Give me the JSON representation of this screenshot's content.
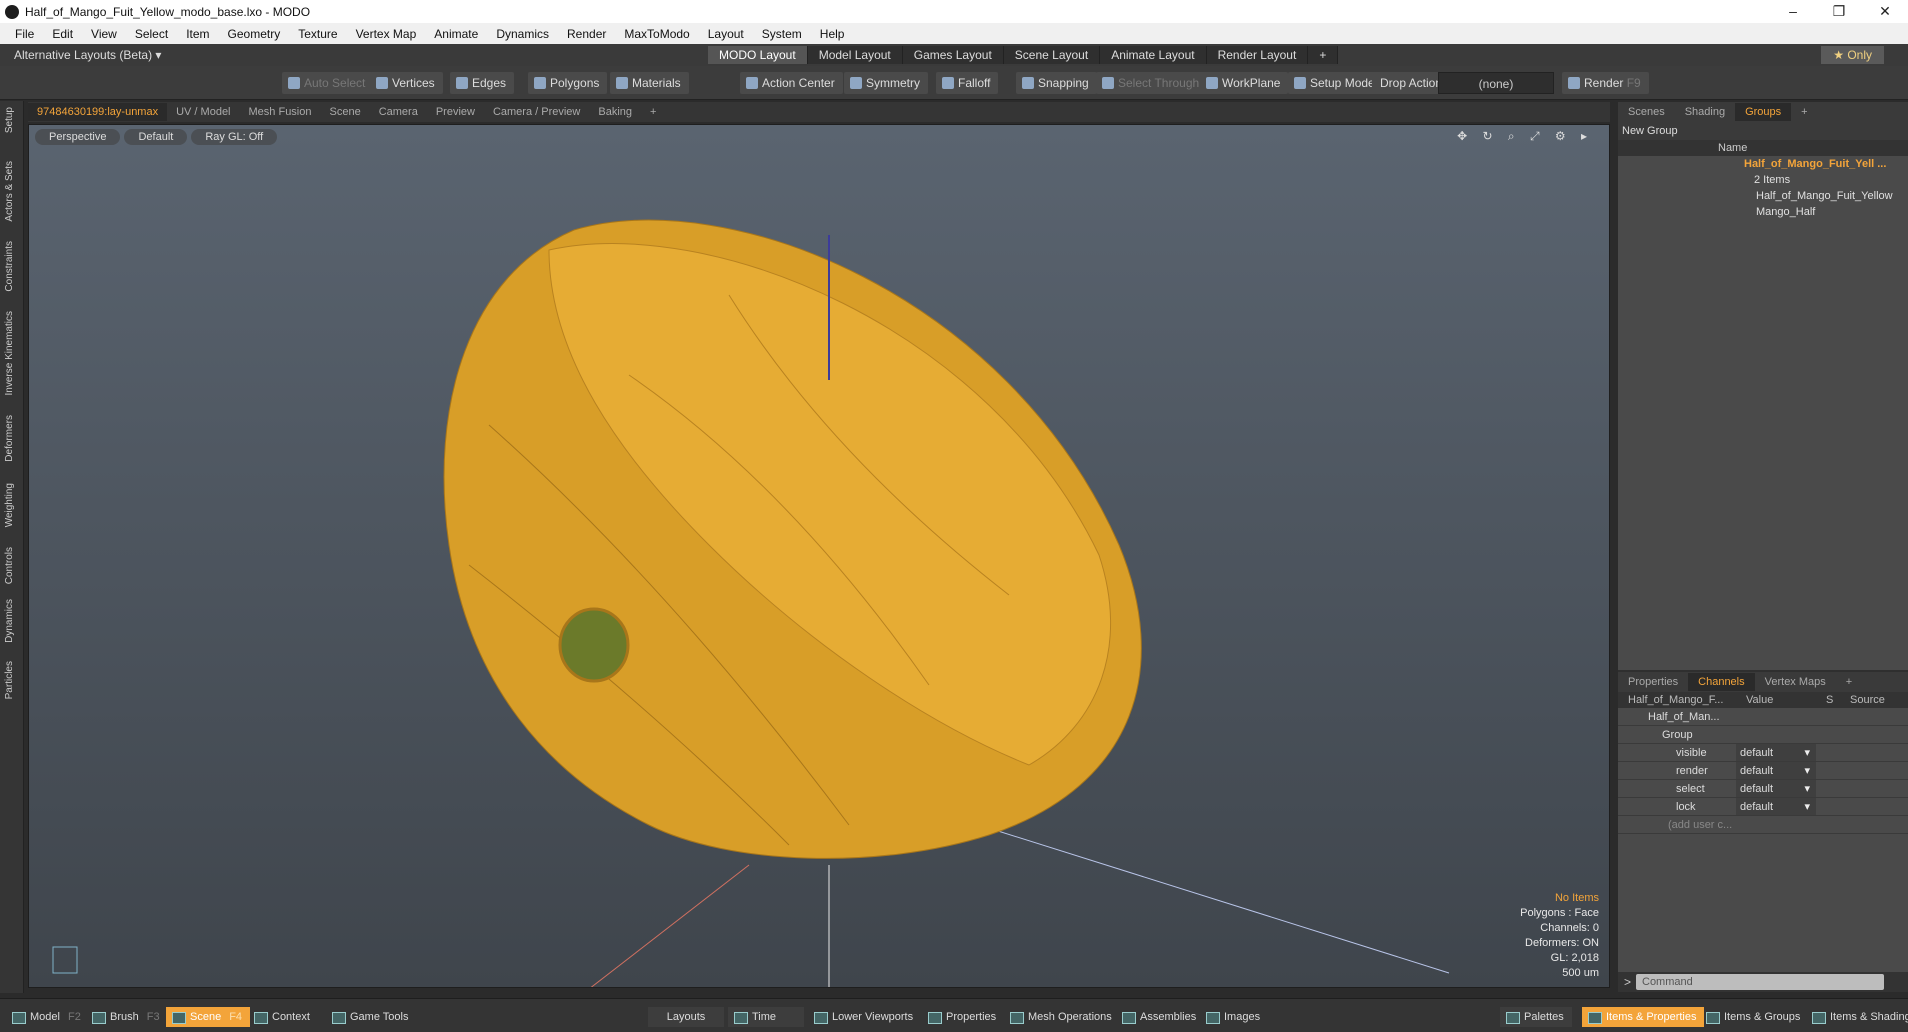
{
  "window": {
    "title": "Half_of_Mango_Fuit_Yellow_modo_base.lxo - MODO",
    "minimize": "–",
    "restore": "❐",
    "close": "✕"
  },
  "menu": [
    "File",
    "Edit",
    "View",
    "Select",
    "Item",
    "Geometry",
    "Texture",
    "Vertex Map",
    "Animate",
    "Dynamics",
    "Render",
    "MaxToModo",
    "Layout",
    "System",
    "Help"
  ],
  "layouts": {
    "alternative": "Alternative Layouts (Beta) ▾",
    "tabs": [
      "MODO Layout",
      "Model Layout",
      "Games Layout",
      "Scene Layout",
      "Animate Layout",
      "Render Layout"
    ],
    "add": "+",
    "only": "★ Only"
  },
  "toolbar": {
    "auto_select": "Auto Select",
    "vertices": "Vertices",
    "edges": "Edges",
    "polygons": "Polygons",
    "materials": "Materials",
    "action_center": "Action Center",
    "symmetry": "Symmetry",
    "falloff": "Falloff",
    "snapping": "Snapping",
    "select_through": "Select Through",
    "workplane": "WorkPlane",
    "setup_mode": "Setup Mode",
    "drop_action": "Drop Action",
    "drop_value": "(none)",
    "render": "Render",
    "render_key": "F9"
  },
  "left_strip": [
    "Setup",
    "Actors & Sets",
    "Constraints",
    "Inverse Kinematics",
    "Deformers",
    "Weighting",
    "Controls",
    "Dynamics",
    "Particles"
  ],
  "viewport_tabs": [
    "97484630199:lay-unmax",
    "UV / Model",
    "Mesh Fusion",
    "Scene",
    "Camera",
    "Preview",
    "Camera / Preview",
    "Baking",
    "+"
  ],
  "viewport": {
    "view": "Perspective",
    "style": "Default",
    "raygl": "Ray GL: Off",
    "info": {
      "items": "No Items",
      "polygons": "Polygons : Face",
      "channels": "Channels: 0",
      "deformers": "Deformers: ON",
      "gl": "GL: 2,018",
      "scale": "500 um"
    }
  },
  "right_tabs": [
    "Scenes",
    "Shading",
    "Groups",
    "+"
  ],
  "groups": {
    "new_group": "New Group",
    "name_header": "Name",
    "group_name": "Half_of_Mango_Fuit_Yell ...",
    "count": "2 Items",
    "items": [
      "Half_of_Mango_Fuit_Yellow",
      "Mango_Half"
    ]
  },
  "channel_tabs": [
    "Properties",
    "Channels",
    "Vertex Maps",
    "+"
  ],
  "channels": {
    "headers": [
      "Half_of_Mango_F...",
      "Value",
      "S",
      "Source"
    ],
    "root": "Half_of_Man...",
    "group": "Group",
    "rows": [
      {
        "name": "visible",
        "value": "default"
      },
      {
        "name": "render",
        "value": "default"
      },
      {
        "name": "select",
        "value": "default"
      },
      {
        "name": "lock",
        "value": "default"
      }
    ],
    "add": "(add user c..."
  },
  "command": {
    "prompt": ">",
    "placeholder": "Command"
  },
  "bottom": {
    "model": "Model",
    "model_key": "F2",
    "brush": "Brush",
    "brush_key": "F3",
    "scene": "Scene",
    "scene_key": "F4",
    "context": "Context",
    "game_tools": "Game Tools",
    "layouts": "Layouts",
    "time": "Time",
    "lower_viewports": "Lower Viewports",
    "properties": "Properties",
    "mesh_operations": "Mesh Operations",
    "assemblies": "Assemblies",
    "images": "Images",
    "palettes": "Palettes",
    "items_properties": "Items & Properties",
    "items_groups": "Items & Groups",
    "items_shading": "Items & Shading"
  }
}
